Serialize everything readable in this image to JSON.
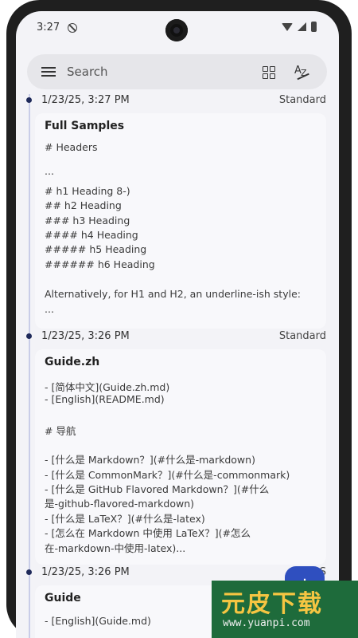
{
  "status": {
    "time": "3:27"
  },
  "search": {
    "placeholder": "Search"
  },
  "entries": [
    {
      "date": "1/23/25, 3:27 PM",
      "type": "Standard",
      "title": "Full Samples",
      "lines": [
        "# Headers",
        "",
        "...",
        "",
        "# h1 Heading 8-)",
        "## h2 Heading",
        "### h3 Heading",
        "#### h4 Heading",
        "##### h5 Heading",
        "###### h6 Heading",
        "",
        "Alternatively, for H1 and H2, an underline-ish style:",
        "..."
      ]
    },
    {
      "date": "1/23/25, 3:26 PM",
      "type": "Standard",
      "title": "Guide.zh",
      "lines": [
        "- [简体中文](Guide.zh.md)",
        "- [English](README.md)",
        "",
        "# 导航",
        "",
        "- [什么是 Markdown？](#什么是-markdown)",
        "- [什么是 CommonMark？](#什么是-commonmark)",
        "- [什么是 GitHub Flavored Markdown？](#什么",
        "是-github-flavored-markdown)",
        "- [什么是 LaTeX？](#什么是-latex)",
        "- [怎么在 Markdown 中使用 LaTeX？](#怎么",
        "在-markdown-中使用-latex)..."
      ]
    },
    {
      "date": "1/23/25, 3:26 PM",
      "type": "S",
      "title": "Guide",
      "lines": [
        "- [English](Guide.md)"
      ]
    }
  ],
  "fab": {
    "label": "+"
  },
  "watermark": {
    "title": "元皮下载",
    "url": "www.yuanpi.com"
  }
}
